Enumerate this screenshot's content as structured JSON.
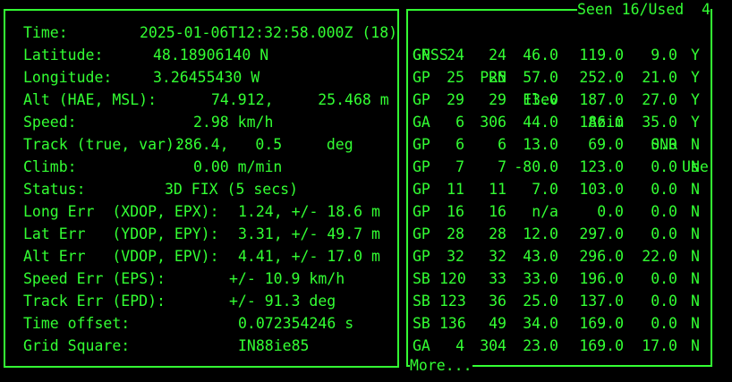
{
  "fix_panel": {
    "rows": [
      {
        "label": "Time:",
        "value": "2025-01-06T12:32:58.000Z (18)"
      },
      {
        "label": "Latitude:",
        "value": "48.18906140 N"
      },
      {
        "label": "Longitude:",
        "value": "3.26455430 W"
      },
      {
        "label": "Alt (HAE, MSL):",
        "value": "74.912,     25.468 m"
      },
      {
        "label": "Speed:",
        "value": "2.98 km/h"
      },
      {
        "label": "Track (true, var):",
        "value": "286.4,   0.5     deg"
      },
      {
        "label": "Climb:",
        "value": "0.00 m/min"
      },
      {
        "label": "Status:",
        "value": "3D FIX (5 secs)"
      },
      {
        "label": "Long Err  (XDOP, EPX):",
        "value": "1.24, +/- 18.6 m"
      },
      {
        "label": "Lat Err   (YDOP, EPY):",
        "value": "3.31, +/- 49.7 m"
      },
      {
        "label": "Alt Err   (VDOP, EPV):",
        "value": "4.41, +/- 17.0 m"
      },
      {
        "label": "Speed Err (EPS):",
        "value": "+/- 10.9 km/h"
      },
      {
        "label": "Track Err (EPD):",
        "value": "+/- 91.3 deg"
      },
      {
        "label": "Time offset:",
        "value": "0.072354246 s"
      },
      {
        "label": "Grid Square:",
        "value": "IN88ie85"
      }
    ]
  },
  "sat_panel": {
    "title": "Seen 16/Used  4",
    "footer": "More...",
    "headers": {
      "gnss": "GNSS",
      "prn": "PRN",
      "elev": "Elev",
      "azim": "Azim",
      "snr": "SNR",
      "use": "Use"
    },
    "rows": [
      {
        "gnss": "GP",
        "id": "24",
        "prn": "24",
        "elev": "46.0",
        "azim": "119.0",
        "snr": "9.0",
        "use": "Y"
      },
      {
        "gnss": "GP",
        "id": "25",
        "prn": "25",
        "elev": "57.0",
        "azim": "252.0",
        "snr": "21.0",
        "use": "Y"
      },
      {
        "gnss": "GP",
        "id": "29",
        "prn": "29",
        "elev": "13.0",
        "azim": "187.0",
        "snr": "27.0",
        "use": "Y"
      },
      {
        "gnss": "GA",
        "id": "6",
        "prn": "306",
        "elev": "44.0",
        "azim": "186.0",
        "snr": "35.0",
        "use": "Y"
      },
      {
        "gnss": "GP",
        "id": "6",
        "prn": "6",
        "elev": "13.0",
        "azim": "69.0",
        "snr": "0.0",
        "use": "N"
      },
      {
        "gnss": "GP",
        "id": "7",
        "prn": "7",
        "elev": "-80.0",
        "azim": "123.0",
        "snr": "0.0",
        "use": "N"
      },
      {
        "gnss": "GP",
        "id": "11",
        "prn": "11",
        "elev": "7.0",
        "azim": "103.0",
        "snr": "0.0",
        "use": "N"
      },
      {
        "gnss": "GP",
        "id": "16",
        "prn": "16",
        "elev": "n/a",
        "azim": "0.0",
        "snr": "0.0",
        "use": "N"
      },
      {
        "gnss": "GP",
        "id": "28",
        "prn": "28",
        "elev": "12.0",
        "azim": "297.0",
        "snr": "0.0",
        "use": "N"
      },
      {
        "gnss": "GP",
        "id": "32",
        "prn": "32",
        "elev": "43.0",
        "azim": "296.0",
        "snr": "22.0",
        "use": "N"
      },
      {
        "gnss": "SB",
        "id": "120",
        "prn": "33",
        "elev": "33.0",
        "azim": "196.0",
        "snr": "0.0",
        "use": "N"
      },
      {
        "gnss": "SB",
        "id": "123",
        "prn": "36",
        "elev": "25.0",
        "azim": "137.0",
        "snr": "0.0",
        "use": "N"
      },
      {
        "gnss": "SB",
        "id": "136",
        "prn": "49",
        "elev": "34.0",
        "azim": "169.0",
        "snr": "0.0",
        "use": "N"
      },
      {
        "gnss": "GA",
        "id": "4",
        "prn": "304",
        "elev": "23.0",
        "azim": "169.0",
        "snr": "17.0",
        "use": "N"
      }
    ]
  },
  "colors": {
    "foreground": "#33ff33",
    "background": "#000000"
  }
}
